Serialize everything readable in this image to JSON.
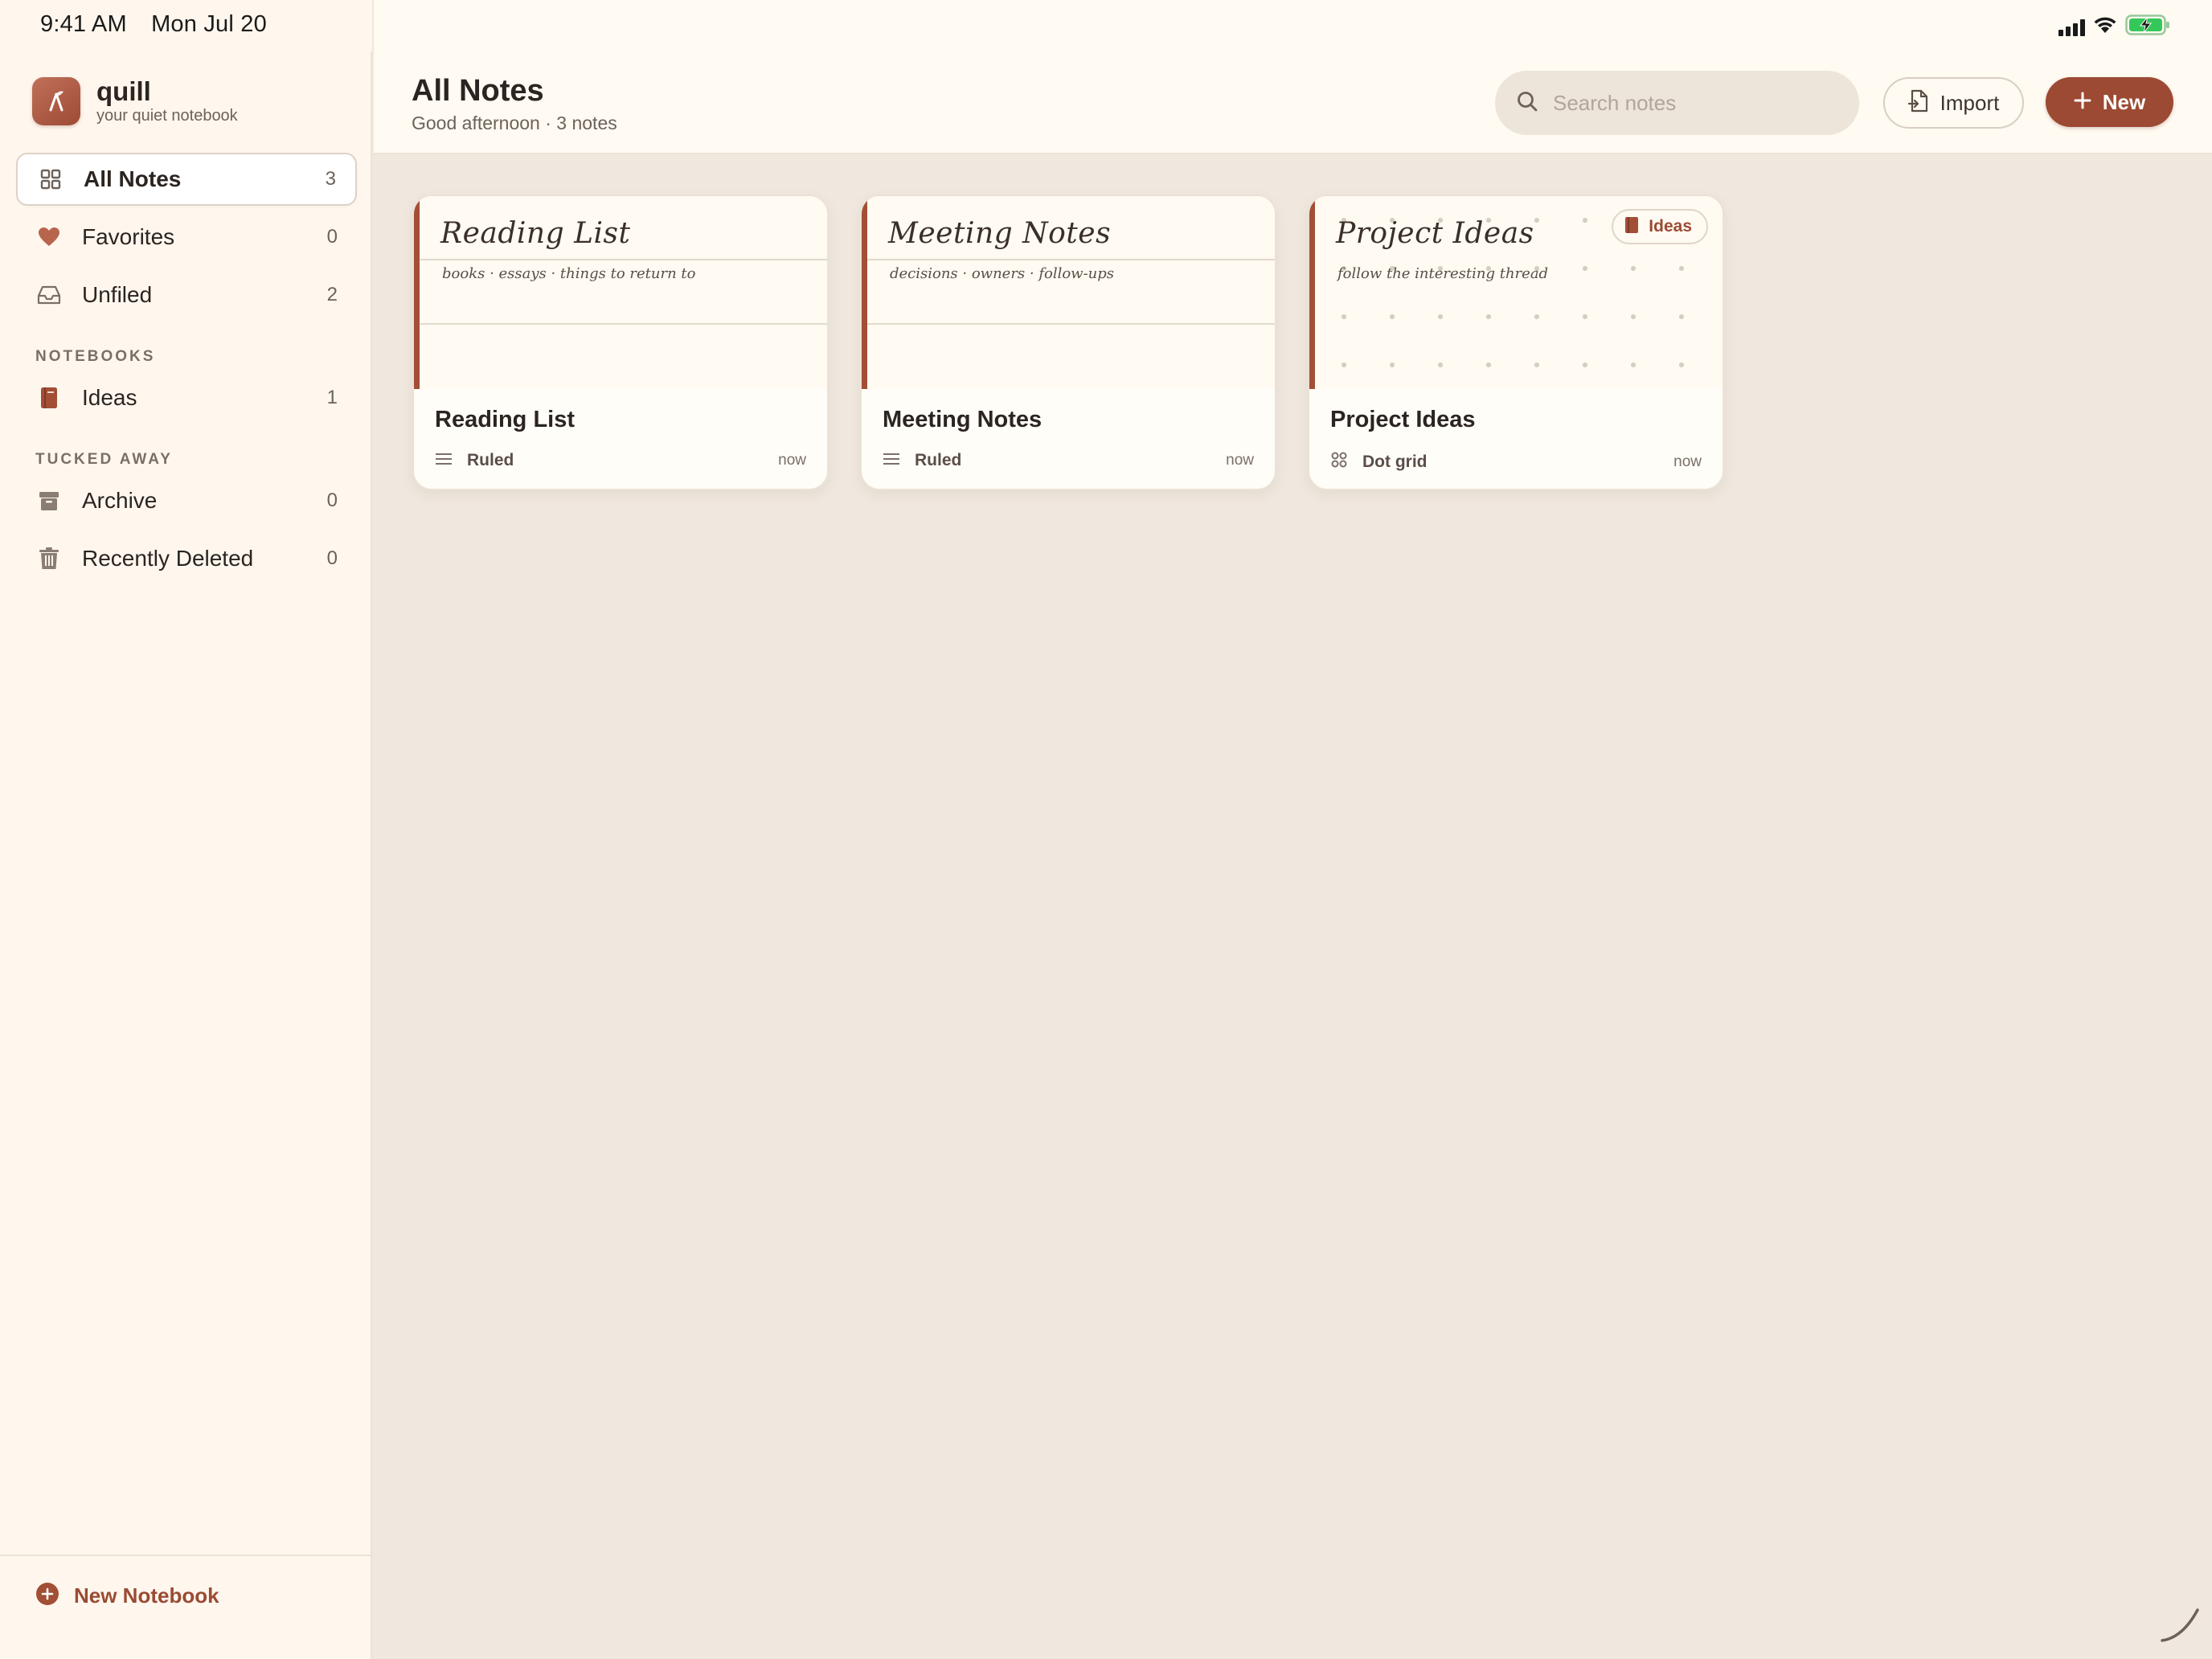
{
  "status_bar": {
    "time": "9:41 AM",
    "date": "Mon Jul 20"
  },
  "brand": {
    "name": "quill",
    "tagline": "your quiet notebook"
  },
  "nav": {
    "items": [
      {
        "label": "All Notes",
        "count": "3",
        "icon": "grid-icon"
      },
      {
        "label": "Favorites",
        "count": "0",
        "icon": "heart-icon"
      },
      {
        "label": "Unfiled",
        "count": "2",
        "icon": "inbox-icon"
      }
    ],
    "notebooks_title": "NOTEBOOKS",
    "notebooks": [
      {
        "label": "Ideas",
        "count": "1",
        "icon": "book-icon"
      }
    ],
    "tucked_title": "TUCKED AWAY",
    "tucked": [
      {
        "label": "Archive",
        "count": "0",
        "icon": "archive-icon"
      },
      {
        "label": "Recently Deleted",
        "count": "0",
        "icon": "trash-icon"
      }
    ]
  },
  "footer": {
    "new_notebook_label": "New Notebook"
  },
  "header": {
    "title": "All Notes",
    "subtitle": "Good afternoon · 3 notes",
    "search_placeholder": "Search notes",
    "import_label": "Import",
    "new_label": "New"
  },
  "notes": [
    {
      "cover_title": "Reading List",
      "cover_sub": "books · essays · things to return to",
      "title": "Reading List",
      "style": "Ruled",
      "time": "now",
      "tag": ""
    },
    {
      "cover_title": "Meeting Notes",
      "cover_sub": "decisions · owners · follow-ups",
      "title": "Meeting Notes",
      "style": "Ruled",
      "time": "now",
      "tag": ""
    },
    {
      "cover_title": "Project Ideas",
      "cover_sub": "follow the interesting thread",
      "title": "Project Ideas",
      "style": "Dot grid",
      "time": "now",
      "tag": "Ideas"
    }
  ],
  "colors": {
    "accent": "#9c4a33",
    "sidebar_bg": "#fff7ee",
    "content_bg": "#f0e8df",
    "card_spine": "#a24f36"
  }
}
